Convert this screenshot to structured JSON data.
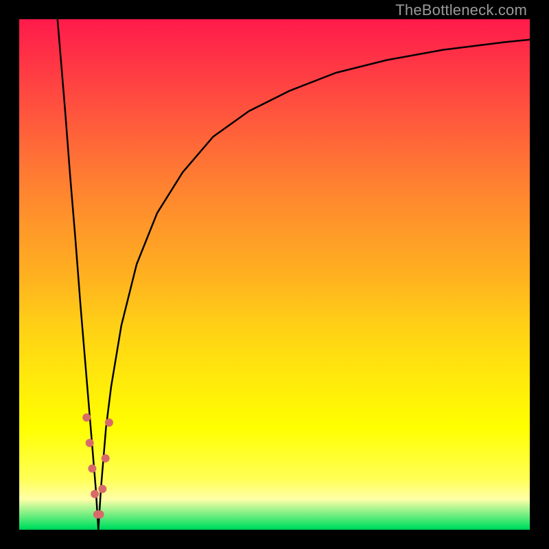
{
  "watermark": {
    "text": "TheBottleneck.com"
  },
  "colors": {
    "frame": "#000000",
    "curve": "#000000",
    "dot": "#d86a6a",
    "gradient_top": "#ff1a4b",
    "gradient_bottom": "#00c050"
  },
  "chart_data": {
    "type": "line",
    "title": "",
    "xlabel": "",
    "ylabel": "",
    "xlim": [
      0,
      100
    ],
    "ylim": [
      0,
      100
    ],
    "grid": false,
    "notes": "Gradient background encodes bottleneck severity from red (high) at top to green (low) at bottom. Two black curves form a V around x≈15.5 where bottleneck reaches 0.",
    "series": [
      {
        "name": "left-branch",
        "x": [
          7.5,
          8,
          9,
          10,
          11,
          12,
          13,
          14,
          15,
          15.5
        ],
        "y": [
          100,
          94,
          82,
          69,
          57,
          44,
          32,
          20,
          8,
          0
        ]
      },
      {
        "name": "right-branch",
        "x": [
          15.5,
          16,
          17,
          18,
          20,
          23,
          27,
          32,
          38,
          45,
          53,
          62,
          72,
          83,
          95,
          100
        ],
        "y": [
          0,
          8,
          20,
          28,
          40,
          52,
          62,
          70,
          77,
          82,
          86,
          89.5,
          92,
          94,
          95.5,
          96
        ]
      }
    ],
    "dots": {
      "name": "highlight-dots",
      "points": [
        {
          "x": 13.2,
          "y": 22
        },
        {
          "x": 13.8,
          "y": 17
        },
        {
          "x": 14.3,
          "y": 12
        },
        {
          "x": 14.8,
          "y": 7
        },
        {
          "x": 15.3,
          "y": 3
        },
        {
          "x": 15.8,
          "y": 3
        },
        {
          "x": 16.3,
          "y": 8
        },
        {
          "x": 16.9,
          "y": 14
        },
        {
          "x": 17.6,
          "y": 21
        }
      ],
      "radius_px": 6
    }
  }
}
